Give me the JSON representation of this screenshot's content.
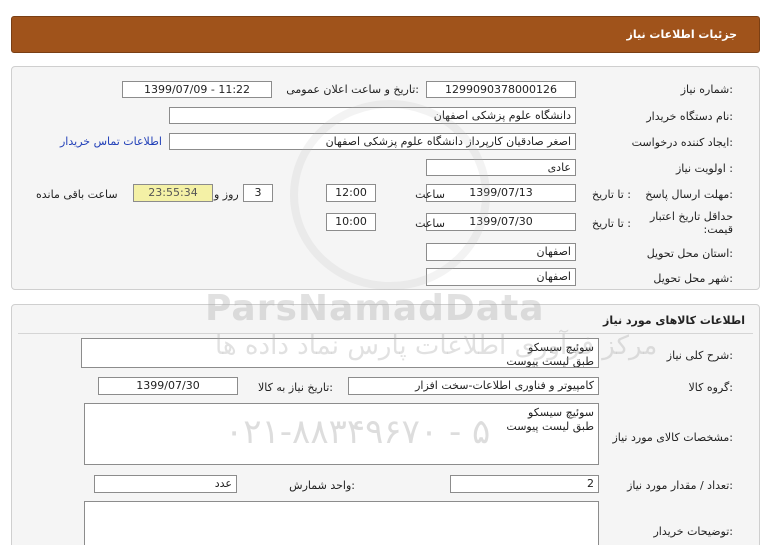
{
  "header": {
    "title": "جزئیات اطلاعات نیاز"
  },
  "need_info": {
    "need_number_label": "شماره نیاز:",
    "need_number": "1299090378000126",
    "announce_label": "تاریخ و ساعت اعلان عمومی:",
    "announce_value": "1399/07/09 - 11:22",
    "buyer_org_label": "نام دستگاه خریدار:",
    "buyer_org": "دانشگاه علوم پزشکی اصفهان",
    "creator_label": "ایجاد کننده درخواست:",
    "creator": "اصغر صادقیان کارپرداز دانشگاه علوم پزشکی اصفهان",
    "contact_link": "اطلاعات تماس خریدار",
    "priority_label": "اولویت نیاز :",
    "priority": "عادی",
    "deadline_label": "مهلت ارسال پاسخ:",
    "to_date_label": "تا تاریخ :",
    "deadline_date": "1399/07/13",
    "time_label": "ساعت",
    "deadline_time": "12:00",
    "days_value": "3",
    "days_label": "روز و",
    "remaining_time": "23:55:34",
    "remaining_label": "ساعت باقی مانده",
    "validity_label": "حداقل تاریخ اعتبار قیمت:",
    "validity_to_label": "تا تاریخ :",
    "validity_date": "1399/07/30",
    "validity_time_label": "ساعت",
    "validity_time": "10:00",
    "province_label": "استان محل تحویل:",
    "province": "اصفهان",
    "city_label": "شهر محل تحویل:",
    "city": "اصفهان"
  },
  "goods": {
    "section_title": "اطلاعات کالاهای مورد نیاز",
    "summary_label": "شرح کلی نیاز:",
    "summary": "سوئیچ سیسکو\nطبق لیست پیوست",
    "group_label": "گروه کالا:",
    "group": "کامپیوتر و فناوری اطلاعات-سخت افزار",
    "need_date_label": "تاریخ نیاز به کالا:",
    "need_date": "1399/07/30",
    "specs_label": "مشخصات کالای مورد نیاز:",
    "specs": "سوئیچ سیسکو\nطبق لیست پیوست",
    "qty_label": "تعداد / مقدار مورد نیاز:",
    "qty": "2",
    "unit_label": "واحد شمارش:",
    "unit": "عدد",
    "buyer_notes_label": "توضیحات خریدار:",
    "buyer_notes": ""
  },
  "watermark": {
    "logo_text": "ParsNamadData",
    "tagline": "مرکز فرآوری اطلاعات پارس نماد داده ها",
    "phone": "۰۲۱-۸۸۳۴۹۶۷۰ - ۵"
  }
}
